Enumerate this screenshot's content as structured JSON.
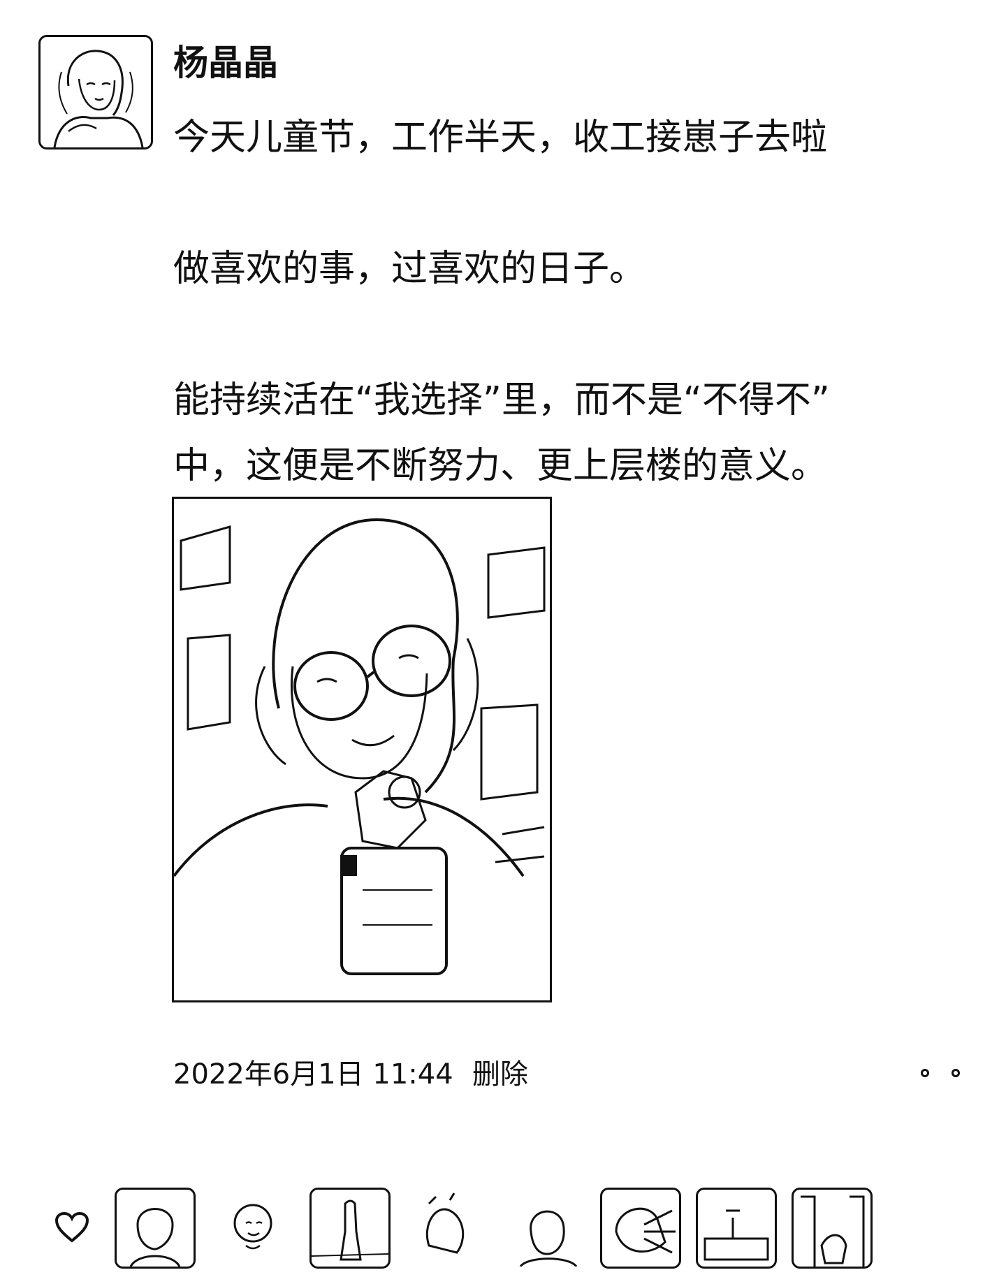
{
  "post": {
    "username": "杨晶晶",
    "lines": [
      "今天儿童节，工作半天，收工接崽子去啦",
      "做喜欢的事，过喜欢的日子。",
      "能持续活在“我选择”里，而不是“不得不”",
      "中，这便是不断努力、更上层楼的意义。"
    ],
    "timestamp": "2022年6月1日 11:44",
    "delete_label": "删除"
  },
  "likes": {
    "icon": "heart-icon",
    "avatars": [
      "liker-avatar-1",
      "liker-avatar-2",
      "liker-avatar-3",
      "liker-avatar-4",
      "liker-avatar-5",
      "liker-avatar-6",
      "liker-avatar-7",
      "liker-avatar-8"
    ]
  },
  "colors": {
    "ink": "#111111",
    "background": "#ffffff"
  }
}
